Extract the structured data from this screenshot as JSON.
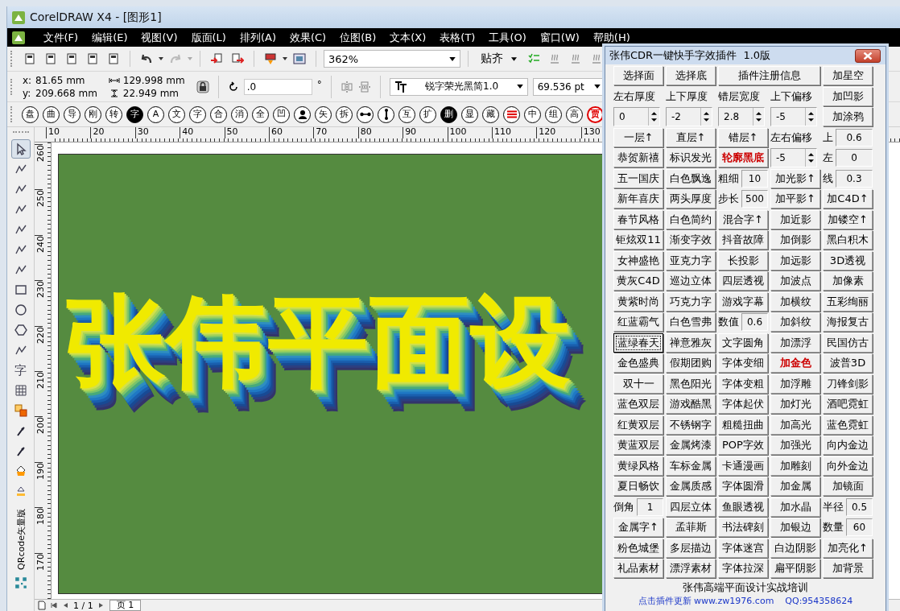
{
  "window": {
    "title": "CorelDRAW X4 - [图形1]"
  },
  "menu": [
    "文件(F)",
    "编辑(E)",
    "视图(V)",
    "版面(L)",
    "排列(A)",
    "效果(C)",
    "位图(B)",
    "文本(X)",
    "表格(T)",
    "工具(O)",
    "窗口(W)",
    "帮助(H)"
  ],
  "toolbar": {
    "zoom": "362%",
    "snap": "贴齐"
  },
  "property_bar": {
    "x_label": "x:",
    "x": "81.65 mm",
    "y_label": "y:",
    "y": "209.668 mm",
    "width": "129.998 mm",
    "height": "22.949 mm",
    "rotation": ".0",
    "degree": "°",
    "font": "锐字荣光黑简1.0",
    "font_size": "69.536 pt"
  },
  "glyph_toolbar": [
    {
      "kind": "char",
      "label": "盘",
      "inverted": false
    },
    {
      "kind": "char",
      "label": "曲",
      "inverted": false
    },
    {
      "kind": "char",
      "label": "导",
      "inverted": false
    },
    {
      "kind": "char",
      "label": "刚",
      "inverted": false
    },
    {
      "kind": "char",
      "label": "转",
      "inverted": false
    },
    {
      "kind": "char",
      "label": "字",
      "inverted": true
    },
    {
      "kind": "char",
      "label": "A",
      "inverted": false
    },
    {
      "kind": "char",
      "label": "文",
      "inverted": false
    },
    {
      "kind": "char",
      "label": "字",
      "inverted": false
    },
    {
      "kind": "char",
      "label": "合",
      "inverted": false
    },
    {
      "kind": "char",
      "label": "消",
      "inverted": false
    },
    {
      "kind": "char",
      "label": "全",
      "inverted": false
    },
    {
      "kind": "char",
      "label": "凹",
      "inverted": false
    },
    {
      "kind": "person",
      "inverted": false
    },
    {
      "kind": "char",
      "label": "矢",
      "inverted": false
    },
    {
      "kind": "char",
      "label": "拆",
      "inverted": false
    },
    {
      "kind": "link",
      "inverted": false
    },
    {
      "kind": "ibeam",
      "inverted": false
    },
    {
      "kind": "char",
      "label": "互",
      "inverted": false
    },
    {
      "kind": "char",
      "label": "扩",
      "inverted": false
    },
    {
      "kind": "char",
      "label": "删",
      "inverted": true
    },
    {
      "kind": "char",
      "label": "显",
      "inverted": false
    },
    {
      "kind": "char",
      "label": "藏",
      "inverted": false
    },
    {
      "kind": "lines",
      "inverted": false,
      "color": "#e00000"
    },
    {
      "kind": "char",
      "label": "中",
      "inverted": false
    },
    {
      "kind": "char",
      "label": "组",
      "inverted": false
    },
    {
      "kind": "char",
      "label": "高",
      "inverted": false
    },
    {
      "kind": "char",
      "label": "贾",
      "inverted": false,
      "color": "#e00000"
    }
  ],
  "rulers": {
    "horizontal": [
      "10",
      "20",
      "30",
      "40",
      "50",
      "60",
      "70",
      "80",
      "90",
      "100",
      "110",
      "120",
      "130"
    ],
    "vertical": [
      "260",
      "250",
      "240",
      "230",
      "220",
      "210",
      "200",
      "190",
      "180",
      "170"
    ]
  },
  "toolbox": {
    "text_tool": "字",
    "qr_label": "QRcode矢量版"
  },
  "canvas": {
    "art_text": "张伟平面设"
  },
  "page_nav": {
    "pages": "1 / 1",
    "tab": "页 1"
  },
  "plugin": {
    "title": "张伟CDR一键快手字效插件  1.0版",
    "rows": [
      [
        {
          "kind": "button",
          "label": "选择面",
          "focused": false
        },
        {
          "kind": "button",
          "label": "选择底",
          "focused": false
        },
        {
          "kind": "wide_button",
          "label": "插件注册信息",
          "focused": false
        },
        "",
        {
          "kind": "button",
          "label": "加星空",
          "focused": false
        }
      ],
      [
        {
          "kind": "label",
          "label": "左右厚度"
        },
        {
          "kind": "label",
          "label": "上下厚度"
        },
        {
          "kind": "label",
          "label": "错层宽度"
        },
        {
          "kind": "label",
          "label": "上下偏移"
        },
        {
          "kind": "button",
          "label": "加凹影",
          "focused": false
        }
      ],
      [
        {
          "kind": "spinner",
          "value": "0"
        },
        {
          "kind": "spinner",
          "value": "-2"
        },
        {
          "kind": "spinner",
          "value": "2.8"
        },
        {
          "kind": "spinner",
          "value": "-5"
        },
        {
          "kind": "button",
          "label": "加涂鸦",
          "focused": false
        }
      ],
      [
        {
          "kind": "button",
          "label": "一层↑",
          "focused": false
        },
        {
          "kind": "button",
          "label": "直层↑",
          "focused": false
        },
        {
          "kind": "button",
          "label": "错层↑",
          "focused": false
        },
        {
          "kind": "label",
          "label": "左右偏移"
        },
        {
          "kind": "field",
          "label": "上",
          "value": "0.6"
        }
      ],
      [
        {
          "kind": "button",
          "label": "恭贺新禧",
          "focused": false
        },
        {
          "kind": "button",
          "label": "标识发光",
          "focused": false
        },
        {
          "kind": "button",
          "label": "轮廓黑底",
          "focused": false,
          "color": "#cc0000"
        },
        {
          "kind": "spinner",
          "value": "-5"
        },
        {
          "kind": "field",
          "label": "左",
          "value": "0"
        }
      ],
      [
        {
          "kind": "button",
          "label": "五一国庆",
          "focused": false
        },
        {
          "kind": "button",
          "label": "白色飘逸",
          "focused": false
        },
        {
          "kind": "field",
          "label": "粗细",
          "value": "10"
        },
        {
          "kind": "button",
          "label": "加光影↑",
          "focused": false
        },
        {
          "kind": "field",
          "label": "线",
          "value": "0.3"
        }
      ],
      [
        {
          "kind": "button",
          "label": "新年喜庆",
          "focused": false
        },
        {
          "kind": "button",
          "label": "两头厚度",
          "focused": false
        },
        {
          "kind": "field",
          "label": "步长",
          "value": "500"
        },
        {
          "kind": "button",
          "label": "加平影↑",
          "focused": false
        },
        {
          "kind": "button",
          "label": "加C4D↑",
          "focused": false
        }
      ],
      [
        {
          "kind": "button",
          "label": "春节风格",
          "focused": false
        },
        {
          "kind": "button",
          "label": "白色简约",
          "focused": false
        },
        {
          "kind": "button",
          "label": "混合字↑",
          "focused": false
        },
        {
          "kind": "button",
          "label": "加近影",
          "focused": false
        },
        {
          "kind": "button",
          "label": "加镂空↑",
          "focused": false
        }
      ],
      [
        {
          "kind": "button",
          "label": "钜炫双11",
          "focused": false
        },
        {
          "kind": "button",
          "label": "渐变字效",
          "focused": false
        },
        {
          "kind": "button",
          "label": "抖音故障",
          "focused": false
        },
        {
          "kind": "button",
          "label": "加倒影",
          "focused": false
        },
        {
          "kind": "button",
          "label": "黑白积木",
          "focused": false
        }
      ],
      [
        {
          "kind": "button",
          "label": "女神盛艳",
          "focused": false
        },
        {
          "kind": "button",
          "label": "亚克力字",
          "focused": false
        },
        {
          "kind": "button",
          "label": "长投影",
          "focused": false
        },
        {
          "kind": "button",
          "label": "加远影",
          "focused": false
        },
        {
          "kind": "button",
          "label": "3D透视",
          "focused": false
        }
      ],
      [
        {
          "kind": "button",
          "label": "黄灰C4D",
          "focused": false
        },
        {
          "kind": "button",
          "label": "巡边立体",
          "focused": false
        },
        {
          "kind": "button",
          "label": "四层透视",
          "focused": false
        },
        {
          "kind": "button",
          "label": "加波点",
          "focused": false
        },
        {
          "kind": "button",
          "label": "加像素",
          "focused": false
        }
      ],
      [
        {
          "kind": "button",
          "label": "黄紫时尚",
          "focused": false
        },
        {
          "kind": "button",
          "label": "巧克力字",
          "focused": false
        },
        {
          "kind": "button",
          "label": "游戏字幕",
          "focused": false
        },
        {
          "kind": "button",
          "label": "加横纹",
          "focused": false
        },
        {
          "kind": "button",
          "label": "五彩绚丽",
          "focused": false
        }
      ],
      [
        {
          "kind": "button",
          "label": "红蓝霸气",
          "focused": false
        },
        {
          "kind": "button",
          "label": "白色雪弗",
          "focused": false
        },
        {
          "kind": "field",
          "label": "数值",
          "value": "0.6"
        },
        {
          "kind": "button",
          "label": "加斜纹",
          "focused": false
        },
        {
          "kind": "button",
          "label": "海报复古",
          "focused": false
        }
      ],
      [
        {
          "kind": "button",
          "label": "蓝绿春天",
          "focused": true
        },
        {
          "kind": "button",
          "label": "禅意雅灰",
          "focused": false
        },
        {
          "kind": "button",
          "label": "文字圆角",
          "focused": false
        },
        {
          "kind": "button",
          "label": "加漂浮",
          "focused": false
        },
        {
          "kind": "button",
          "label": "民国仿古",
          "focused": false
        }
      ],
      [
        {
          "kind": "button",
          "label": "金色盛典",
          "focused": false
        },
        {
          "kind": "button",
          "label": "假期团购",
          "focused": false
        },
        {
          "kind": "button",
          "label": "字体变细",
          "focused": false
        },
        {
          "kind": "button",
          "label": "加金色",
          "focused": false,
          "color": "#cc0000"
        },
        {
          "kind": "button",
          "label": "波普3D",
          "focused": false
        }
      ],
      [
        {
          "kind": "button",
          "label": "双十一",
          "focused": false
        },
        {
          "kind": "button",
          "label": "黑色阳光",
          "focused": false
        },
        {
          "kind": "button",
          "label": "字体变粗",
          "focused": false
        },
        {
          "kind": "button",
          "label": "加浮雕",
          "focused": false
        },
        {
          "kind": "button",
          "label": "刀锋剑影",
          "focused": false
        }
      ],
      [
        {
          "kind": "button",
          "label": "蓝色双层",
          "focused": false
        },
        {
          "kind": "button",
          "label": "游戏酷黑",
          "focused": false
        },
        {
          "kind": "button",
          "label": "字体起伏",
          "focused": false
        },
        {
          "kind": "button",
          "label": "加灯光",
          "focused": false
        },
        {
          "kind": "button",
          "label": "酒吧霓虹",
          "focused": false
        }
      ],
      [
        {
          "kind": "button",
          "label": "红黄双层",
          "focused": false
        },
        {
          "kind": "button",
          "label": "不锈钢字",
          "focused": false
        },
        {
          "kind": "button",
          "label": "粗糙扭曲",
          "focused": false
        },
        {
          "kind": "button",
          "label": "加高光",
          "focused": false
        },
        {
          "kind": "button",
          "label": "蓝色霓虹",
          "focused": false
        }
      ],
      [
        {
          "kind": "button",
          "label": "黄蓝双层",
          "focused": false
        },
        {
          "kind": "button",
          "label": "金属烤漆",
          "focused": false
        },
        {
          "kind": "button",
          "label": "POP字效",
          "focused": false
        },
        {
          "kind": "button",
          "label": "加强光",
          "focused": false
        },
        {
          "kind": "button",
          "label": "向内金边",
          "focused": false
        }
      ],
      [
        {
          "kind": "button",
          "label": "黄绿风格",
          "focused": false
        },
        {
          "kind": "button",
          "label": "车标金属",
          "focused": false
        },
        {
          "kind": "button",
          "label": "卡通漫画",
          "focused": false
        },
        {
          "kind": "button",
          "label": "加雕刻",
          "focused": false
        },
        {
          "kind": "button",
          "label": "向外金边",
          "focused": false
        }
      ],
      [
        {
          "kind": "button",
          "label": "夏日畅饮",
          "focused": false
        },
        {
          "kind": "button",
          "label": "金属质感",
          "focused": false
        },
        {
          "kind": "button",
          "label": "字体圆滑",
          "focused": false
        },
        {
          "kind": "button",
          "label": "加金属",
          "focused": false
        },
        {
          "kind": "button",
          "label": "加镜面",
          "focused": false
        }
      ],
      [
        {
          "kind": "field",
          "label": "倒角",
          "value": "1"
        },
        {
          "kind": "button",
          "label": "四层立体",
          "focused": false
        },
        {
          "kind": "button",
          "label": "鱼眼透视",
          "focused": false
        },
        {
          "kind": "button",
          "label": "加水晶",
          "focused": false
        },
        {
          "kind": "field",
          "label": "半径",
          "value": "0.5"
        }
      ],
      [
        {
          "kind": "button",
          "label": "金属字↑",
          "focused": false
        },
        {
          "kind": "button",
          "label": "孟菲斯",
          "focused": false
        },
        {
          "kind": "button",
          "label": "书法碑刻",
          "focused": false
        },
        {
          "kind": "button",
          "label": "加银边",
          "focused": false
        },
        {
          "kind": "field",
          "label": "数量",
          "value": "60"
        }
      ],
      [
        {
          "kind": "button",
          "label": "粉色城堡",
          "focused": false
        },
        {
          "kind": "button",
          "label": "多层描边",
          "focused": false
        },
        {
          "kind": "button",
          "label": "字体迷宫",
          "focused": false
        },
        {
          "kind": "button",
          "label": "白边阴影",
          "focused": false
        },
        {
          "kind": "button",
          "label": "加亮化↑",
          "focused": false
        }
      ],
      [
        {
          "kind": "button",
          "label": "礼品素材",
          "focused": false
        },
        {
          "kind": "button",
          "label": "漂浮素材",
          "focused": false
        },
        {
          "kind": "button",
          "label": "字体拉深",
          "focused": false
        },
        {
          "kind": "button",
          "label": "扁平阴影",
          "focused": false
        },
        {
          "kind": "button",
          "label": "加背景",
          "focused": false
        }
      ]
    ],
    "footer": "张伟高端平面设计实战培训",
    "link": "点击插件更新 www.zw1976.com    QQ:954358624"
  }
}
